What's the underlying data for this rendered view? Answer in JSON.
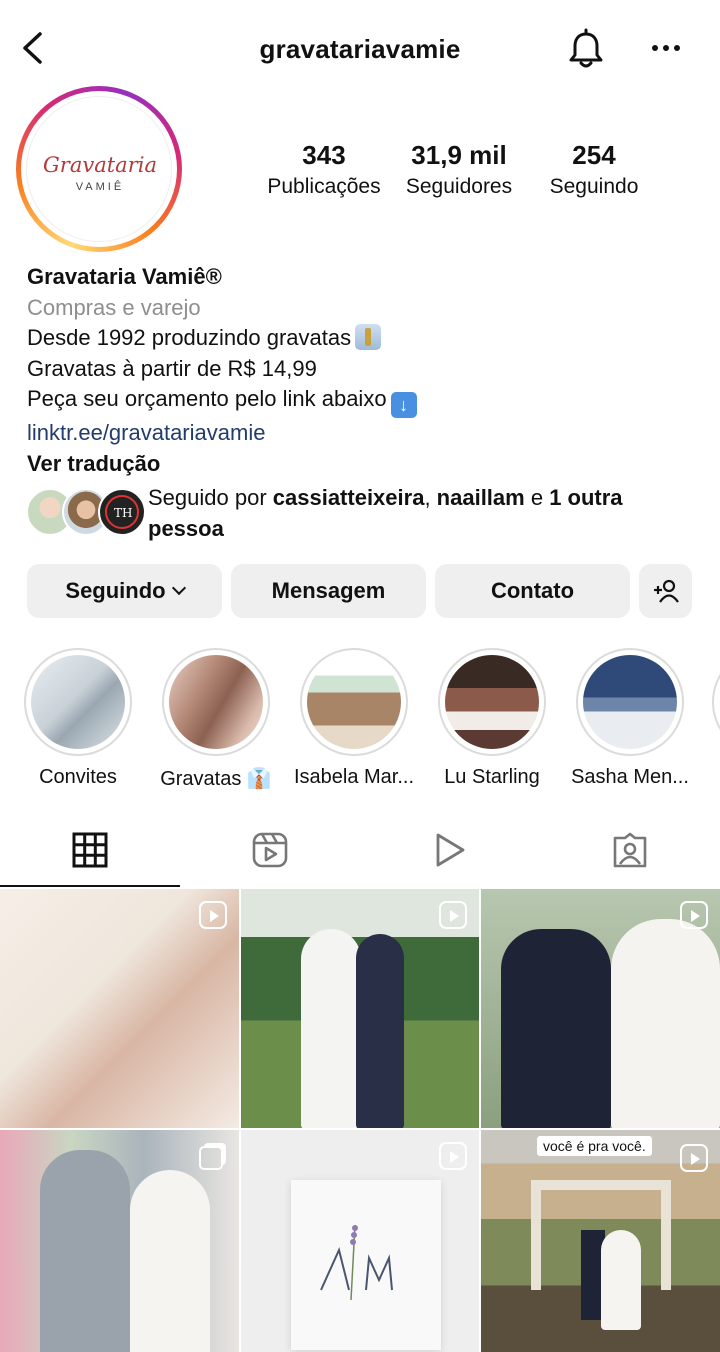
{
  "header": {
    "username": "gravatariavamie"
  },
  "avatar": {
    "logo_line1": "Gravataria",
    "logo_line2": "VAMIÊ"
  },
  "stats": [
    {
      "value": "343",
      "label": "Publicações"
    },
    {
      "value": "31,9 mil",
      "label": "Seguidores"
    },
    {
      "value": "254",
      "label": "Seguindo"
    }
  ],
  "bio": {
    "name": "Gravataria Vamiê®",
    "category": "Compras e varejo",
    "line1": "Desde 1992 produzindo gravatas",
    "line2": "Gravatas à partir de R$ 14,99",
    "line3": "Peça seu orçamento pelo link abaixo",
    "link": "linktr.ee/gravatariavamie",
    "translate": "Ver tradução"
  },
  "followed_by": {
    "prefix": "Seguido por ",
    "user1": "cassiatteixeira",
    "sep": ", ",
    "user2": "naaillam",
    "conj": " e ",
    "others": "1 outra pessoa"
  },
  "buttons": {
    "following": "Seguindo",
    "message": "Mensagem",
    "contact": "Contato"
  },
  "highlights": [
    {
      "label": "Convites"
    },
    {
      "label": "Gravatas 👔"
    },
    {
      "label": "Isabela Mar..."
    },
    {
      "label": "Lu Starling"
    },
    {
      "label": "Sasha Men..."
    }
  ],
  "tabs": [
    "grid-icon",
    "reels-icon",
    "play-icon",
    "tagged-icon"
  ],
  "posts": [
    {
      "caption": ""
    },
    {
      "caption": ""
    },
    {
      "caption": ""
    },
    {
      "caption": ""
    },
    {
      "caption": ""
    },
    {
      "caption": "você é pra você."
    }
  ],
  "colors": {
    "link": "#223c6e",
    "button_bg": "#efefef",
    "muted": "#8e8e8e"
  }
}
